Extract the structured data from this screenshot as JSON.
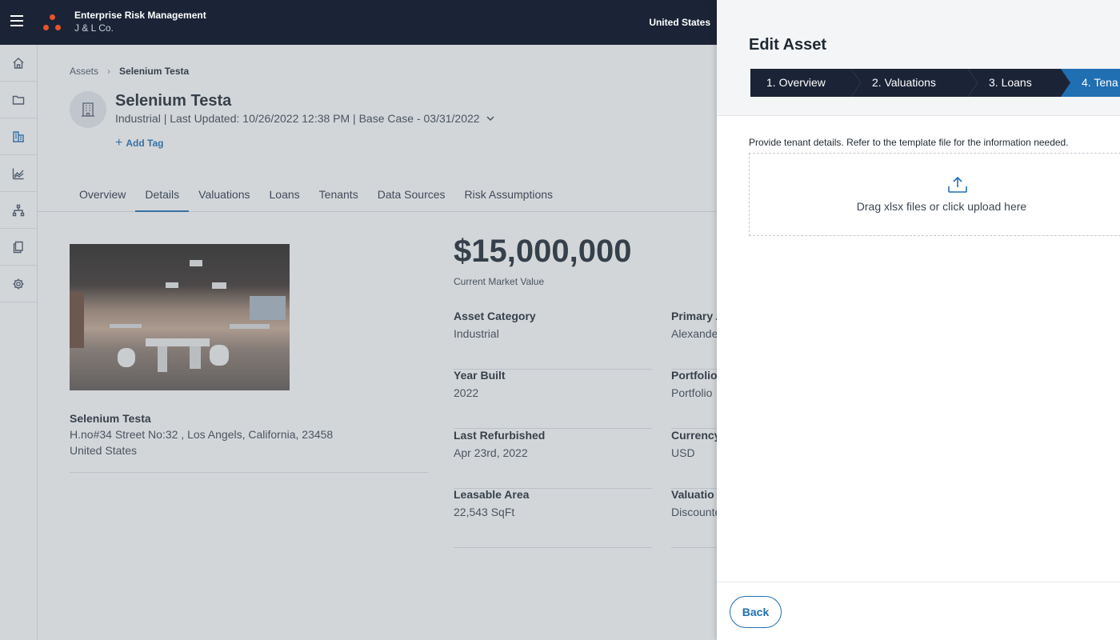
{
  "header": {
    "app_title": "Enterprise Risk Management",
    "company": "J & L Co.",
    "region": "United States"
  },
  "nav": {
    "icons": [
      "home-icon",
      "folder-icon",
      "assets-icon",
      "chart-icon",
      "hierarchy-icon",
      "documents-icon",
      "settings-icon"
    ],
    "active": "assets-icon"
  },
  "breadcrumb": {
    "root": "Assets",
    "current": "Selenium Testa"
  },
  "asset": {
    "name": "Selenium Testa",
    "meta": "Industrial | Last Updated: 10/26/2022 12:38 PM | Base Case - 03/31/2022",
    "add_tag": "Add Tag"
  },
  "tabs": [
    "Overview",
    "Details",
    "Valuations",
    "Loans",
    "Tenants",
    "Data Sources",
    "Risk Assumptions"
  ],
  "active_tab": "Details",
  "location": {
    "name": "Selenium Testa",
    "address": "H.no#34 Street No:32 , Los Angels, California, 23458",
    "country": "United States"
  },
  "value": {
    "amount": "$15,000,000",
    "caption": "Current Market Value"
  },
  "fields": {
    "left": [
      {
        "label": "Asset Category",
        "value": "Industrial"
      },
      {
        "label": "Year Built",
        "value": "2022"
      },
      {
        "label": "Last Refurbished",
        "value": "Apr 23rd, 2022"
      },
      {
        "label": "Leasable Area",
        "value": "22,543 SqFt"
      }
    ],
    "right": [
      {
        "label": "Primary A",
        "value": "Alexande"
      },
      {
        "label": "Portfolio",
        "value": "Portfolio"
      },
      {
        "label": "Currency",
        "value": "USD"
      },
      {
        "label": "Valuatio",
        "value": "Discounte"
      }
    ]
  },
  "drawer": {
    "title": "Edit Asset",
    "steps": [
      "1. Overview",
      "2. Valuations",
      "3. Loans",
      "4. Tena"
    ],
    "current_step": "4. Tena",
    "instructions": "Provide tenant details. Refer to the template file for the information needed.",
    "dropzone_text": "Drag xlsx files or click upload here",
    "back_label": "Back"
  },
  "colors": {
    "topbar": "#1b2436",
    "accent": "#1f6fb2",
    "brand": "#e8542c"
  }
}
